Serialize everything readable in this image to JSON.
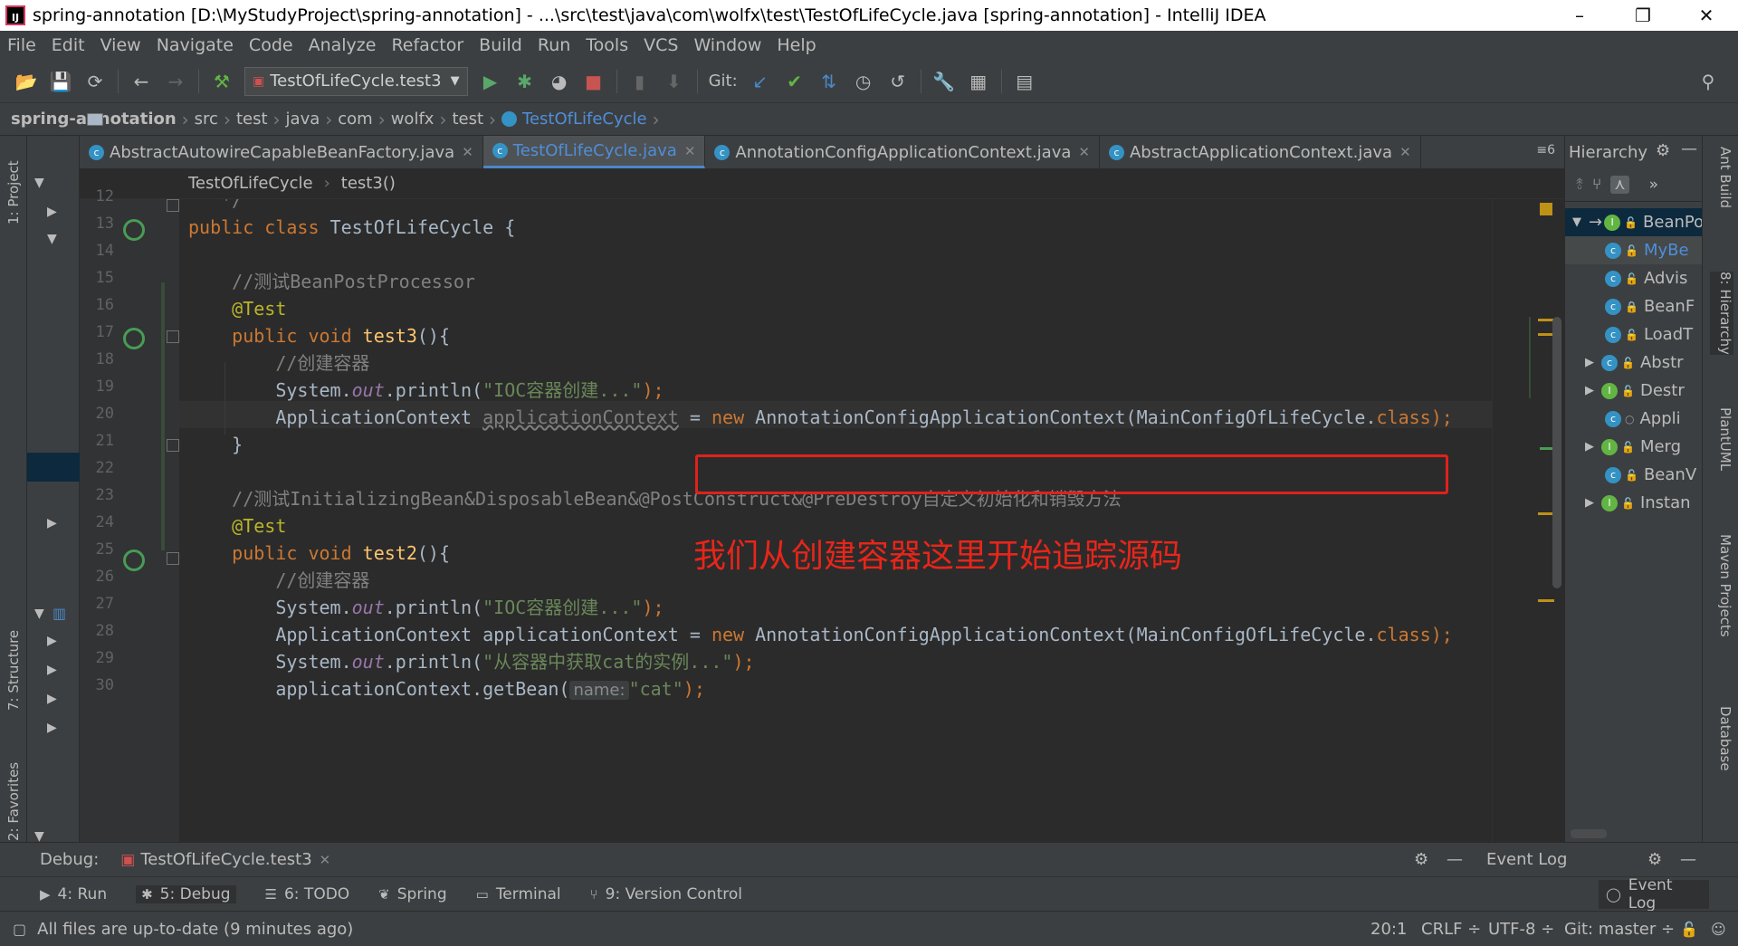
{
  "window": {
    "title": "spring-annotation [D:\\MyStudyProject\\spring-annotation] - ...\\src\\test\\java\\com\\wolfx\\test\\TestOfLifeCycle.java [spring-annotation] - IntelliJ IDEA",
    "app_icon": "IJ",
    "minimize": "–",
    "restore": "❐",
    "close": "✕"
  },
  "menu": [
    "File",
    "Edit",
    "View",
    "Navigate",
    "Code",
    "Analyze",
    "Refactor",
    "Build",
    "Run",
    "Tools",
    "VCS",
    "Window",
    "Help"
  ],
  "toolbar": {
    "run_config": "TestOfLifeCycle.test3",
    "git_label": "Git:"
  },
  "nav": {
    "project": "spring-annotation",
    "crumbs": [
      "src",
      "test",
      "java",
      "com",
      "wolfx",
      "test",
      "TestOfLifeCycle"
    ]
  },
  "tabs": [
    {
      "label": "AbstractAutowireCapableBeanFactory.java"
    },
    {
      "label": "TestOfLifeCycle.java"
    },
    {
      "label": "AnnotationConfigApplicationContext.java"
    },
    {
      "label": "AbstractApplicationContext.java"
    }
  ],
  "tab_overflow": "6",
  "editor_breadcrumb": {
    "cls": "TestOfLifeCycle",
    "method": "test3()"
  },
  "line_numbers": [
    "12",
    "13",
    "14",
    "15",
    "16",
    "17",
    "18",
    "19",
    "20",
    "21",
    "22",
    "23",
    "24",
    "25",
    "26",
    "27",
    "28",
    "29",
    "30"
  ],
  "code": {
    "l13": {
      "kw": "public class ",
      "name": "TestOfLifeCycle {"
    },
    "l15": "//测试BeanPostProcessor",
    "l16": "@Test",
    "l17": {
      "kw": "public void ",
      "fn": "test3",
      "rest": "(){"
    },
    "l18": "//创建容器",
    "l19": {
      "a": "System.",
      "b": "out",
      "c": ".println(",
      "s": "\"IOC容器创建...\"",
      "d": ");"
    },
    "l20": {
      "a": "ApplicationContext ",
      "b": "applicationContext",
      "c": " = ",
      "kw": "new ",
      "d": "AnnotationConfigApplicationContext(MainConfigOfLifeCycle.",
      "cls": "class",
      "e": ");"
    },
    "l21": "}",
    "l23": "//测试InitializingBean&DisposableBean&@PostConstruct&@PreDestroy自定义初始化和销毁方法",
    "l24": "@Test",
    "l25": {
      "kw": "public void ",
      "fn": "test2",
      "rest": "(){"
    },
    "l26": "//创建容器",
    "l27": {
      "a": "System.",
      "b": "out",
      "c": ".println(",
      "s": "\"IOC容器创建...\"",
      "d": ");"
    },
    "l28": {
      "a": "ApplicationContext applicationContext = ",
      "kw": "new ",
      "d": "AnnotationConfigApplicationContext(MainConfigOfLifeCycle.",
      "cls": "class",
      "e": ");"
    },
    "l29": {
      "a": "System.",
      "b": "out",
      "c": ".println(",
      "s": "\"从容器中获取cat的实例...\"",
      "d": ");"
    },
    "l30": {
      "a": "applicationContext.getBean(",
      "hint": "name:",
      "s": "\"cat\"",
      "d": ");"
    }
  },
  "annotation": "我们从创建容器这里开始追踪源码",
  "hierarchy": {
    "title": "Hierarchy",
    "items": [
      "BeanPo",
      "MyBe",
      "Advis",
      "BeanF",
      "LoadT",
      "Abstr",
      "Destr",
      "Appli",
      "Merg",
      "BeanV",
      "Instan"
    ]
  },
  "left_tabs": {
    "project": "1: Project",
    "structure": "7: Structure",
    "favorites": "2: Favorites"
  },
  "right_tabs": {
    "ant": "Ant Build",
    "hierarchy": "8: Hierarchy",
    "plantuml": "PlantUML",
    "maven": "Maven Projects",
    "database": "Database"
  },
  "debug": {
    "label": "Debug:",
    "session": "TestOfLifeCycle.test3",
    "event_log": "Event Log"
  },
  "tooltabs": {
    "run": "4: Run",
    "debug": "5: Debug",
    "todo": "6: TODO",
    "spring": "Spring",
    "terminal": "Terminal",
    "vcs": "9: Version Control",
    "eventlog": "Event Log"
  },
  "status": {
    "message": "All files are up-to-date (9 minutes ago)",
    "pos": "20:1",
    "crlf": "CRLF ÷",
    "enc": "UTF-8 ÷",
    "git": "Git: master ÷"
  }
}
